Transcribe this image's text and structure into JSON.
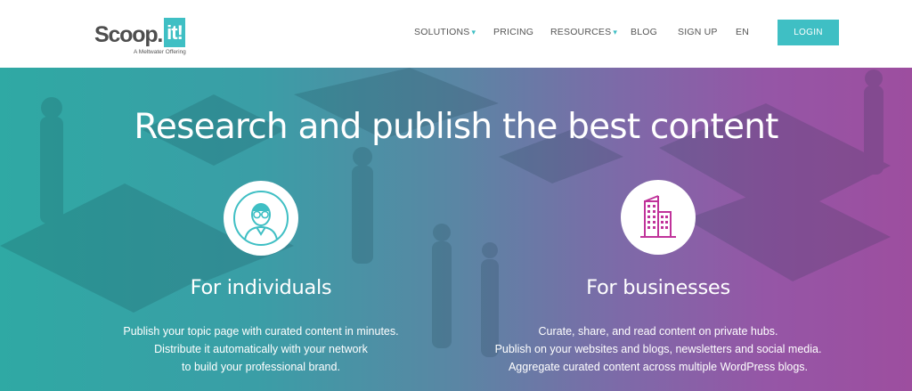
{
  "logo": {
    "word": "Scoop.",
    "mark": "it!",
    "tagline": "A Meltwater Offering"
  },
  "nav": {
    "items": [
      {
        "label": "SOLUTIONS",
        "caret": "▾"
      },
      {
        "label": "PRICING"
      },
      {
        "label": "RESOURCES",
        "caret": "▾"
      },
      {
        "label": "BLOG"
      },
      {
        "label": "SIGN UP"
      },
      {
        "label": "EN"
      }
    ],
    "login_label": "LOGIN"
  },
  "hero": {
    "title": "Research and publish the best content",
    "individuals": {
      "icon": "person-glasses-icon",
      "title": "For individuals",
      "lines": [
        "Publish your topic page with curated content in minutes.",
        "Distribute it automatically with your network",
        "to build your professional brand."
      ]
    },
    "businesses": {
      "icon": "buildings-icon",
      "title": "For businesses",
      "lines": [
        "Curate, share, and read content on private hubs.",
        "Publish on your websites and blogs, newsletters and social media.",
        "Aggregate curated content across multiple WordPress blogs."
      ]
    }
  },
  "colors": {
    "brand_teal": "#3fbfc4",
    "logo_gray": "#4e4e4e",
    "hero_left": "#2fa9a4",
    "hero_right": "#9d4e9f",
    "business_icon": "#c0339a"
  }
}
